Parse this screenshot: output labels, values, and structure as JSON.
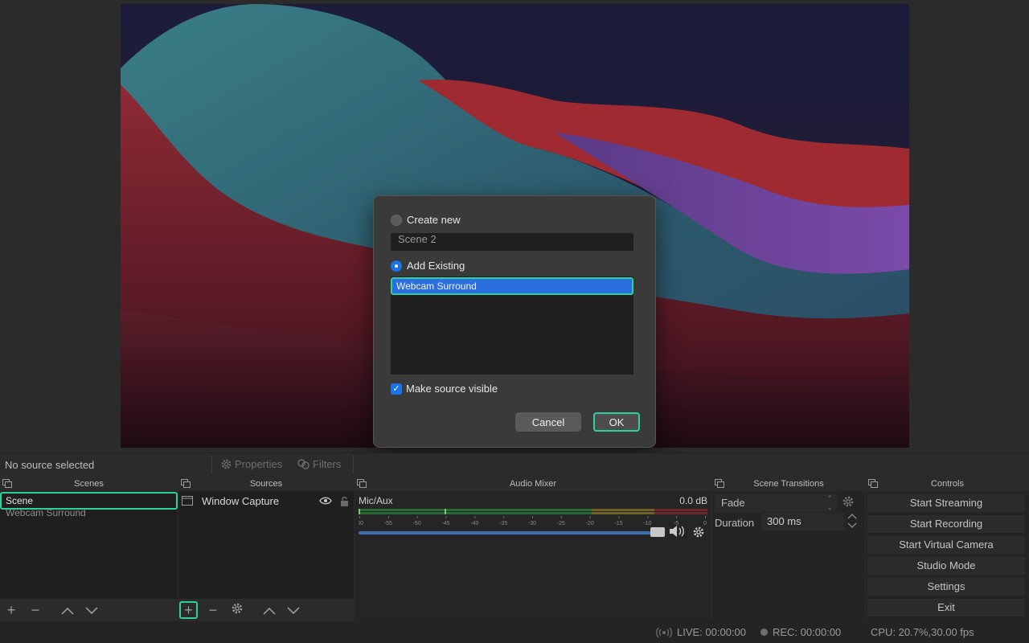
{
  "dialog": {
    "create_new_label": "Create new",
    "new_name_value": "Scene 2",
    "add_existing_label": "Add Existing",
    "existing_items": [
      "Webcam Surround"
    ],
    "make_visible_label": "Make source visible",
    "cancel_label": "Cancel",
    "ok_label": "OK"
  },
  "source_toolbar": {
    "no_source": "No source selected",
    "properties_label": "Properties",
    "filters_label": "Filters"
  },
  "scenes": {
    "title": "Scenes",
    "items": [
      "Scene",
      "Webcam Surround"
    ]
  },
  "sources": {
    "title": "Sources",
    "items": [
      {
        "label": "Window Capture"
      }
    ]
  },
  "mixer": {
    "title": "Audio Mixer",
    "channel": "Mic/Aux",
    "level": "0.0 dB",
    "ticks": [
      "-60",
      "-55",
      "-50",
      "-45",
      "-40",
      "-35",
      "-30",
      "-25",
      "-20",
      "-15",
      "-10",
      "-5",
      "0"
    ]
  },
  "transitions": {
    "title": "Scene Transitions",
    "selected": "Fade",
    "duration_label": "Duration",
    "duration_value": "300 ms"
  },
  "controls": {
    "title": "Controls",
    "buttons": [
      "Start Streaming",
      "Start Recording",
      "Start Virtual Camera",
      "Studio Mode",
      "Settings",
      "Exit"
    ]
  },
  "status": {
    "live": "LIVE: 00:00:00",
    "rec": "REC: 00:00:00",
    "cpu": "CPU: 20.7%,30.00 fps"
  },
  "colors": {
    "accent": "#2fd0a0",
    "selection": "#2b6ede",
    "meter_green": "#2f8a3a",
    "meter_yellow": "#8a7a2a",
    "meter_red": "#8a2f2f"
  }
}
